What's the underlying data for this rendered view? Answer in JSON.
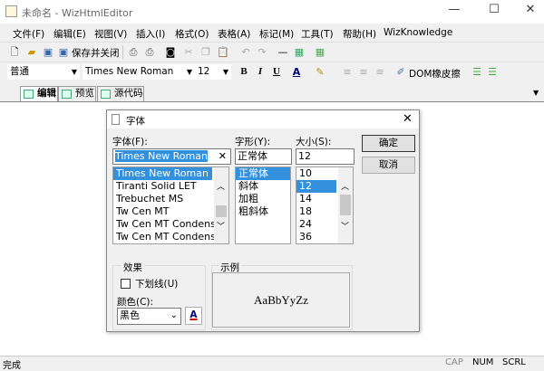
{
  "window": {
    "title": "未命名 - WizHtmlEditor",
    "minimize": "—",
    "maximize": "☐",
    "close": "✕"
  },
  "menu": [
    "文件(F)",
    "编辑(E)",
    "视图(V)",
    "插入(I)",
    "格式(O)",
    "表格(A)",
    "标记(M)",
    "工具(T)",
    "帮助(H)",
    "WizKnowledge"
  ],
  "toolbar1": {
    "save_close": "保存并关闭"
  },
  "toolbar2": {
    "style": "普通",
    "font": "Times New Roman",
    "size": "12",
    "bold": "B",
    "italic": "I",
    "underline": "U",
    "font_color": "A",
    "dom_eraser": "DOM橡皮擦"
  },
  "tabs": [
    "编辑",
    "预览",
    "源代码"
  ],
  "status": {
    "text": "完成",
    "cap": "CAP",
    "num": "NUM",
    "scrl": "SCRL"
  },
  "dialog": {
    "title": "字体",
    "font_label": "字体(F):",
    "font_value": "Times New Roman",
    "fonts": [
      "Times New Roman",
      "Tiranti Solid LET",
      "Trebuchet MS",
      "Tw Cen MT",
      "Tw Cen MT Condensed",
      "Tw Cen MT Condensed"
    ],
    "style_label": "字形(Y):",
    "style_value": "正常体",
    "styles": [
      "正常体",
      "斜体",
      "加粗",
      "粗斜体"
    ],
    "size_label": "大小(S):",
    "size_value": "12",
    "sizes": [
      "10",
      "12",
      "14",
      "18",
      "24",
      "36"
    ],
    "ok": "确定",
    "cancel": "取消",
    "effects_label": "效果",
    "underline_label": "下划线(U)",
    "color_label": "颜色(C):",
    "color_value": "黑色",
    "sample_label": "示例",
    "sample_text": "AaBbYyZz"
  }
}
